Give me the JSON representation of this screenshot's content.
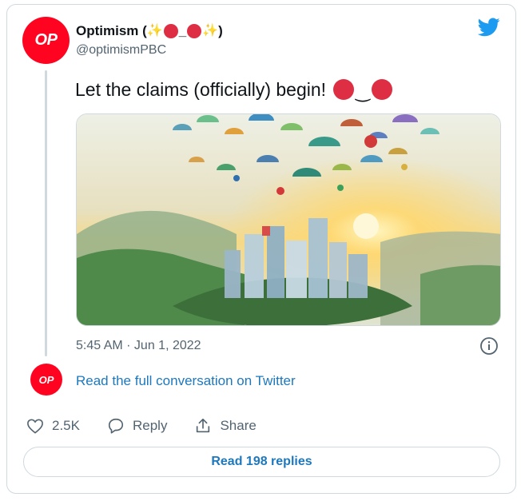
{
  "author": {
    "name": "Optimism (",
    "name_close": ")",
    "handle": "@optimismPBC",
    "avatar_text": "OP"
  },
  "tweet": {
    "text": "Let the claims (officially) begin!",
    "timestamp": "5:45 AM · Jun 1, 2022"
  },
  "conversation": {
    "avatar_text": "OP",
    "link_label": "Read the full conversation on Twitter"
  },
  "actions": {
    "like_count": "2.5K",
    "reply_label": "Reply",
    "share_label": "Share"
  },
  "replies_button": "Read 198 replies",
  "colors": {
    "brand_red": "#ff0420",
    "twitter_blue": "#1d9bf0",
    "link_blue": "#1d78bd",
    "muted": "#536471"
  },
  "icons": [
    "twitter-bird-icon",
    "sparkles-icon",
    "red-circle-icon",
    "info-icon",
    "heart-icon",
    "reply-icon",
    "share-icon"
  ]
}
